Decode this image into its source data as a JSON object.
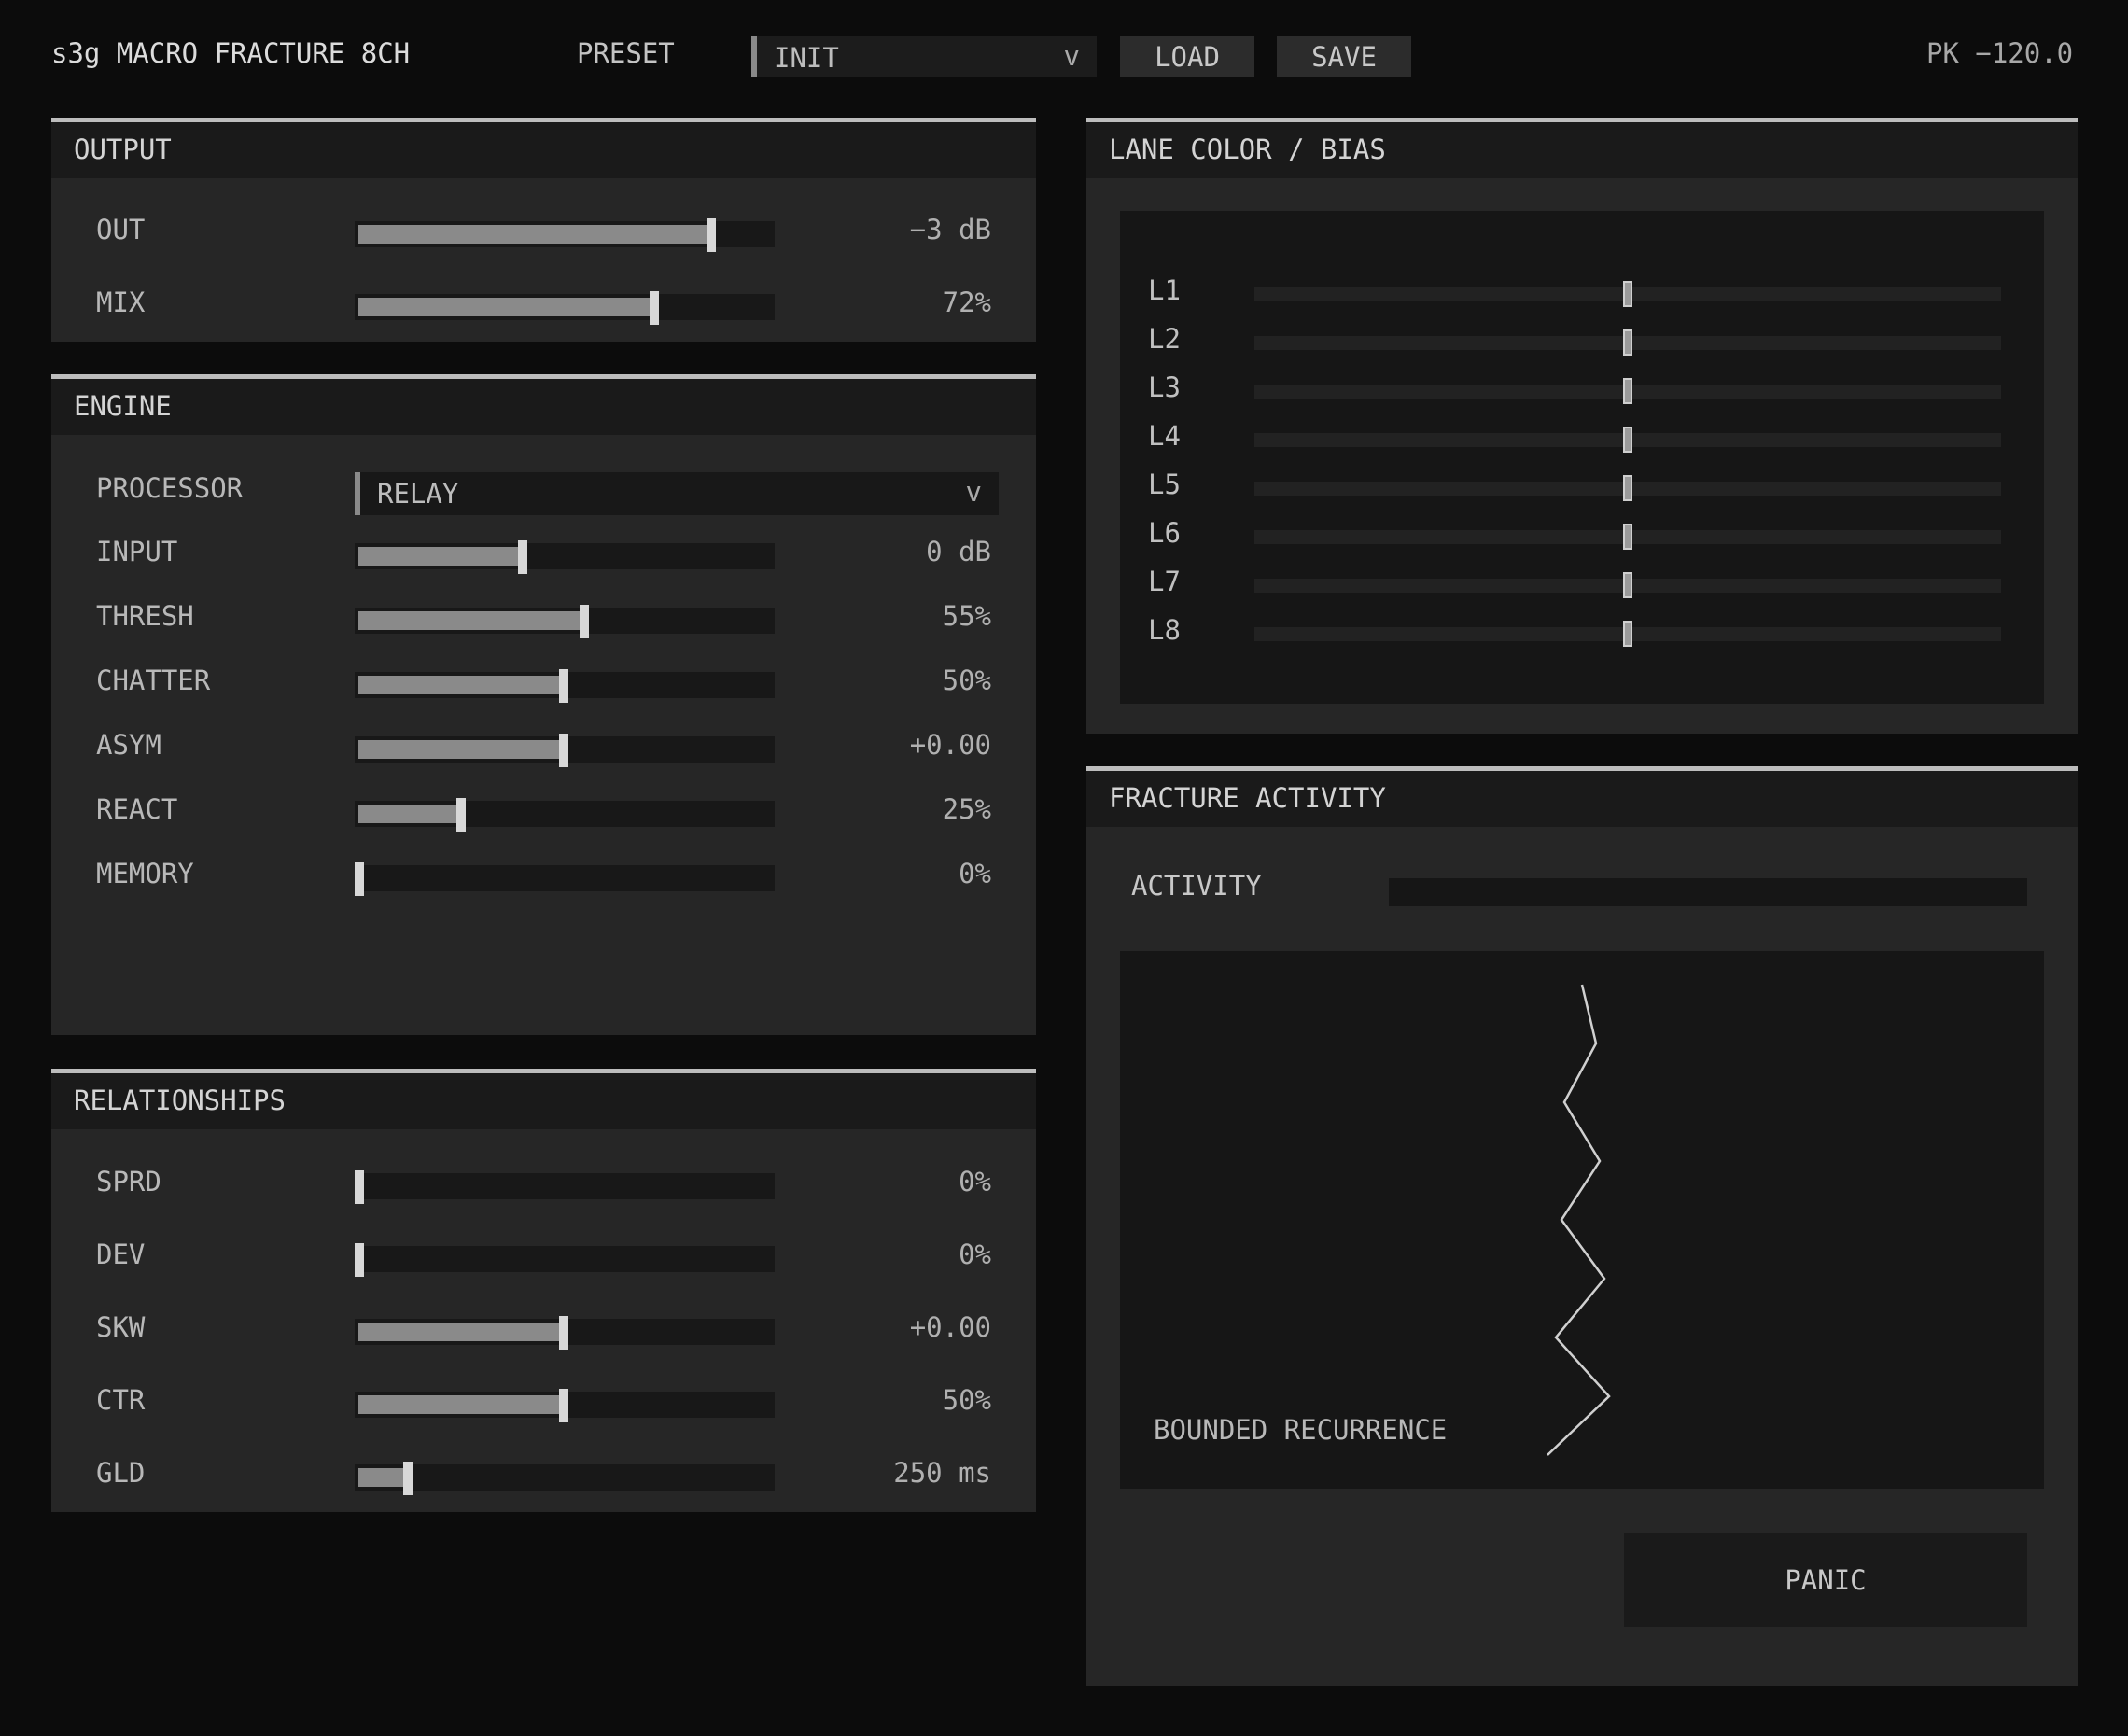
{
  "header": {
    "title": "s3g MACRO FRACTURE 8CH",
    "preset_label": "PRESET",
    "preset_value": "INIT",
    "preset_chevron": "v",
    "load_label": "LOAD",
    "save_label": "SAVE",
    "peak_readout": "PK −120.0"
  },
  "output": {
    "title": "OUTPUT",
    "controls": [
      {
        "label": "OUT",
        "value": "−3 dB",
        "level": 0.86
      },
      {
        "label": "MIX",
        "value": "72%",
        "level": 0.72
      }
    ]
  },
  "engine": {
    "title": "ENGINE",
    "processor_label": "PROCESSOR",
    "processor_value": "RELAY",
    "processor_chevron": "v",
    "controls": [
      {
        "label": "INPUT",
        "value": "0 dB",
        "level": 0.4
      },
      {
        "label": "THRESH",
        "value": "55%",
        "level": 0.55
      },
      {
        "label": "CHATTER",
        "value": "50%",
        "level": 0.5
      },
      {
        "label": "ASYM",
        "value": "+0.00",
        "level": 0.5
      },
      {
        "label": "REACT",
        "value": "25%",
        "level": 0.25
      },
      {
        "label": "MEMORY",
        "value": "0%",
        "level": 0.0
      }
    ]
  },
  "relationships": {
    "title": "RELATIONSHIPS",
    "controls": [
      {
        "label": "SPRD",
        "value": "0%",
        "level": 0.0
      },
      {
        "label": "DEV",
        "value": "0%",
        "level": 0.0
      },
      {
        "label": "SKW",
        "value": "+0.00",
        "level": 0.5
      },
      {
        "label": "CTR",
        "value": "50%",
        "level": 0.5
      },
      {
        "label": "GLD",
        "value": "250 ms",
        "level": 0.12
      }
    ]
  },
  "lanes": {
    "title": "LANE COLOR / BIAS",
    "items": [
      {
        "label": "L1",
        "bias": 0.5
      },
      {
        "label": "L2",
        "bias": 0.5
      },
      {
        "label": "L3",
        "bias": 0.5
      },
      {
        "label": "L4",
        "bias": 0.5
      },
      {
        "label": "L5",
        "bias": 0.5
      },
      {
        "label": "L6",
        "bias": 0.5
      },
      {
        "label": "L7",
        "bias": 0.5
      },
      {
        "label": "L8",
        "bias": 0.5
      }
    ]
  },
  "activity": {
    "title": "FRACTURE ACTIVITY",
    "label": "ACTIVITY",
    "level": 0.0,
    "mode_caption": "BOUNDED RECURRENCE",
    "panic_label": "PANIC"
  },
  "colors": {
    "background": "#0c0c0c",
    "panel": "#262626",
    "accent": "#bdbdbd",
    "trace": "#d0d0d0"
  }
}
